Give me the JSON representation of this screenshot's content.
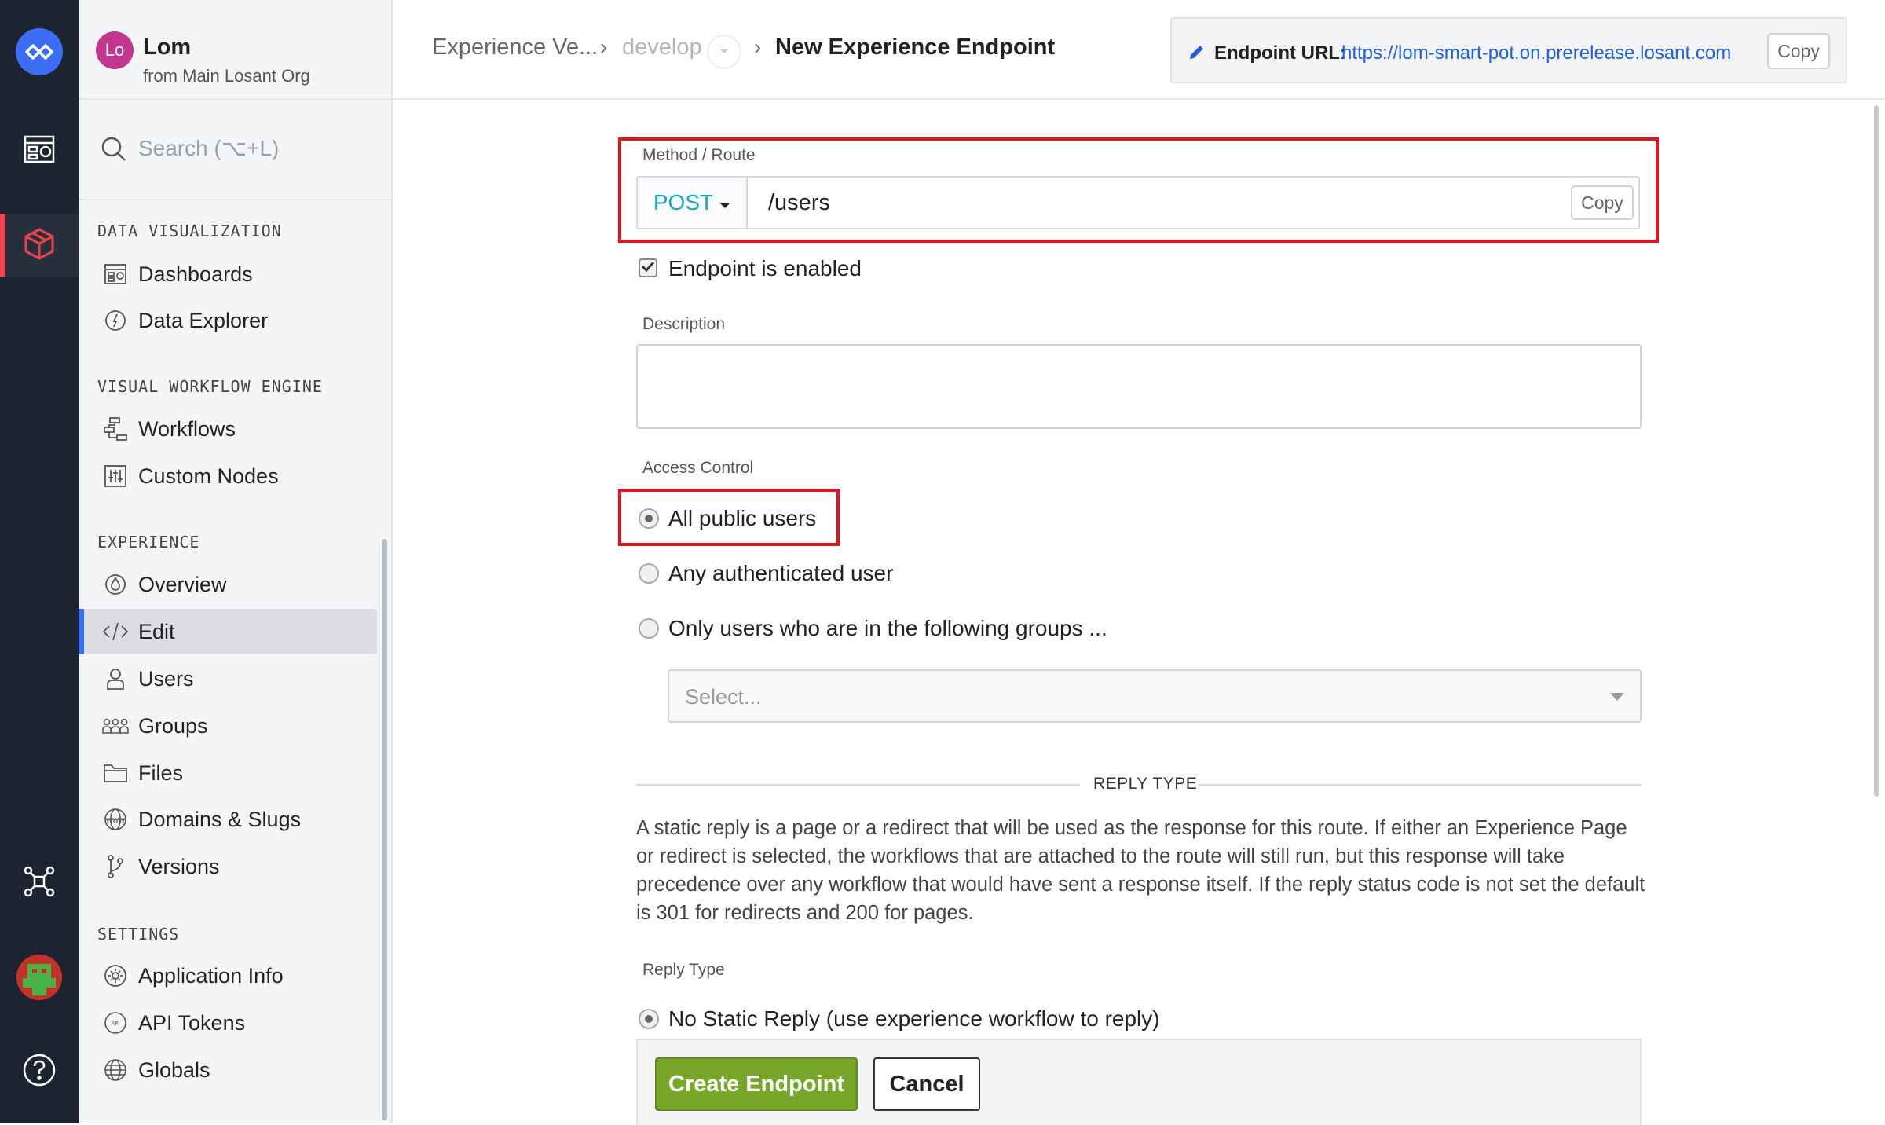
{
  "rail": {
    "items": [
      {
        "icon": "losant-logo-icon"
      },
      {
        "icon": "dashboard-icon"
      },
      {
        "icon": "cube-icon",
        "active": true
      },
      {
        "icon": "network-icon"
      },
      {
        "icon": "user-avatar"
      },
      {
        "icon": "help-icon"
      }
    ]
  },
  "org": {
    "initials": "Lo",
    "name": "Lom",
    "subtitle": "from Main Losant Org"
  },
  "search": {
    "placeholder": "Search (⌥+L)"
  },
  "sidebar": {
    "sections": [
      {
        "title": "DATA VISUALIZATION",
        "items": [
          {
            "label": "Dashboards",
            "icon": "dashboard-icon"
          },
          {
            "label": "Data Explorer",
            "icon": "compass-icon"
          }
        ]
      },
      {
        "title": "VISUAL WORKFLOW ENGINE",
        "items": [
          {
            "label": "Workflows",
            "icon": "workflow-icon"
          },
          {
            "label": "Custom Nodes",
            "icon": "sliders-icon"
          }
        ]
      },
      {
        "title": "EXPERIENCE",
        "items": [
          {
            "label": "Overview",
            "icon": "drop-icon"
          },
          {
            "label": "Edit",
            "icon": "code-icon",
            "active": true
          },
          {
            "label": "Users",
            "icon": "user-icon"
          },
          {
            "label": "Groups",
            "icon": "groups-icon"
          },
          {
            "label": "Files",
            "icon": "folder-icon"
          },
          {
            "label": "Domains & Slugs",
            "icon": "www-icon"
          },
          {
            "label": "Versions",
            "icon": "branch-icon"
          }
        ]
      },
      {
        "title": "SETTINGS",
        "items": [
          {
            "label": "Application Info",
            "icon": "gear-icon"
          },
          {
            "label": "API Tokens",
            "icon": "api-icon"
          },
          {
            "label": "Globals",
            "icon": "globe-icon"
          }
        ]
      }
    ]
  },
  "header": {
    "breadcrumb": [
      "Experience Ve...",
      "develop",
      "New Experience Endpoint"
    ],
    "endpoint_url_label": "Endpoint URL:",
    "endpoint_url": "https://lom-smart-pot.on.prerelease.losant.com",
    "copy_label": "Copy"
  },
  "form": {
    "method_route_label": "Method / Route",
    "method": "POST",
    "route": "/users",
    "route_copy_label": "Copy",
    "enabled_label": "Endpoint is enabled",
    "enabled": true,
    "description_label": "Description",
    "description": "",
    "access_control_label": "Access Control",
    "access_options": [
      {
        "label": "All public users",
        "checked": true
      },
      {
        "label": "Any authenticated user",
        "checked": false
      },
      {
        "label": "Only users who are in the following groups ...",
        "checked": false
      }
    ],
    "groups_placeholder": "Select...",
    "reply_type_heading": "REPLY TYPE",
    "reply_description": "A static reply is a page or a redirect that will be used as the response for this route. If either an Experience Page or redirect is selected, the workflows that are attached to the route will still run, but this response will take precedence over any workflow that would have sent a response itself. If the reply status code is not set the default is 301 for redirects and 200 for pages.",
    "reply_type_label": "Reply Type",
    "reply_options": [
      {
        "label": "No Static Reply (use experience workflow to reply)",
        "checked": true
      }
    ],
    "create_label": "Create Endpoint",
    "cancel_label": "Cancel"
  },
  "colors": {
    "rail_bg": "#1b2430",
    "brand_blue": "#3b6ef5",
    "active_red": "#e8434a",
    "method_cyan": "#19a8c7",
    "create_green": "#78a628",
    "highlight_red": "#e3151b"
  }
}
